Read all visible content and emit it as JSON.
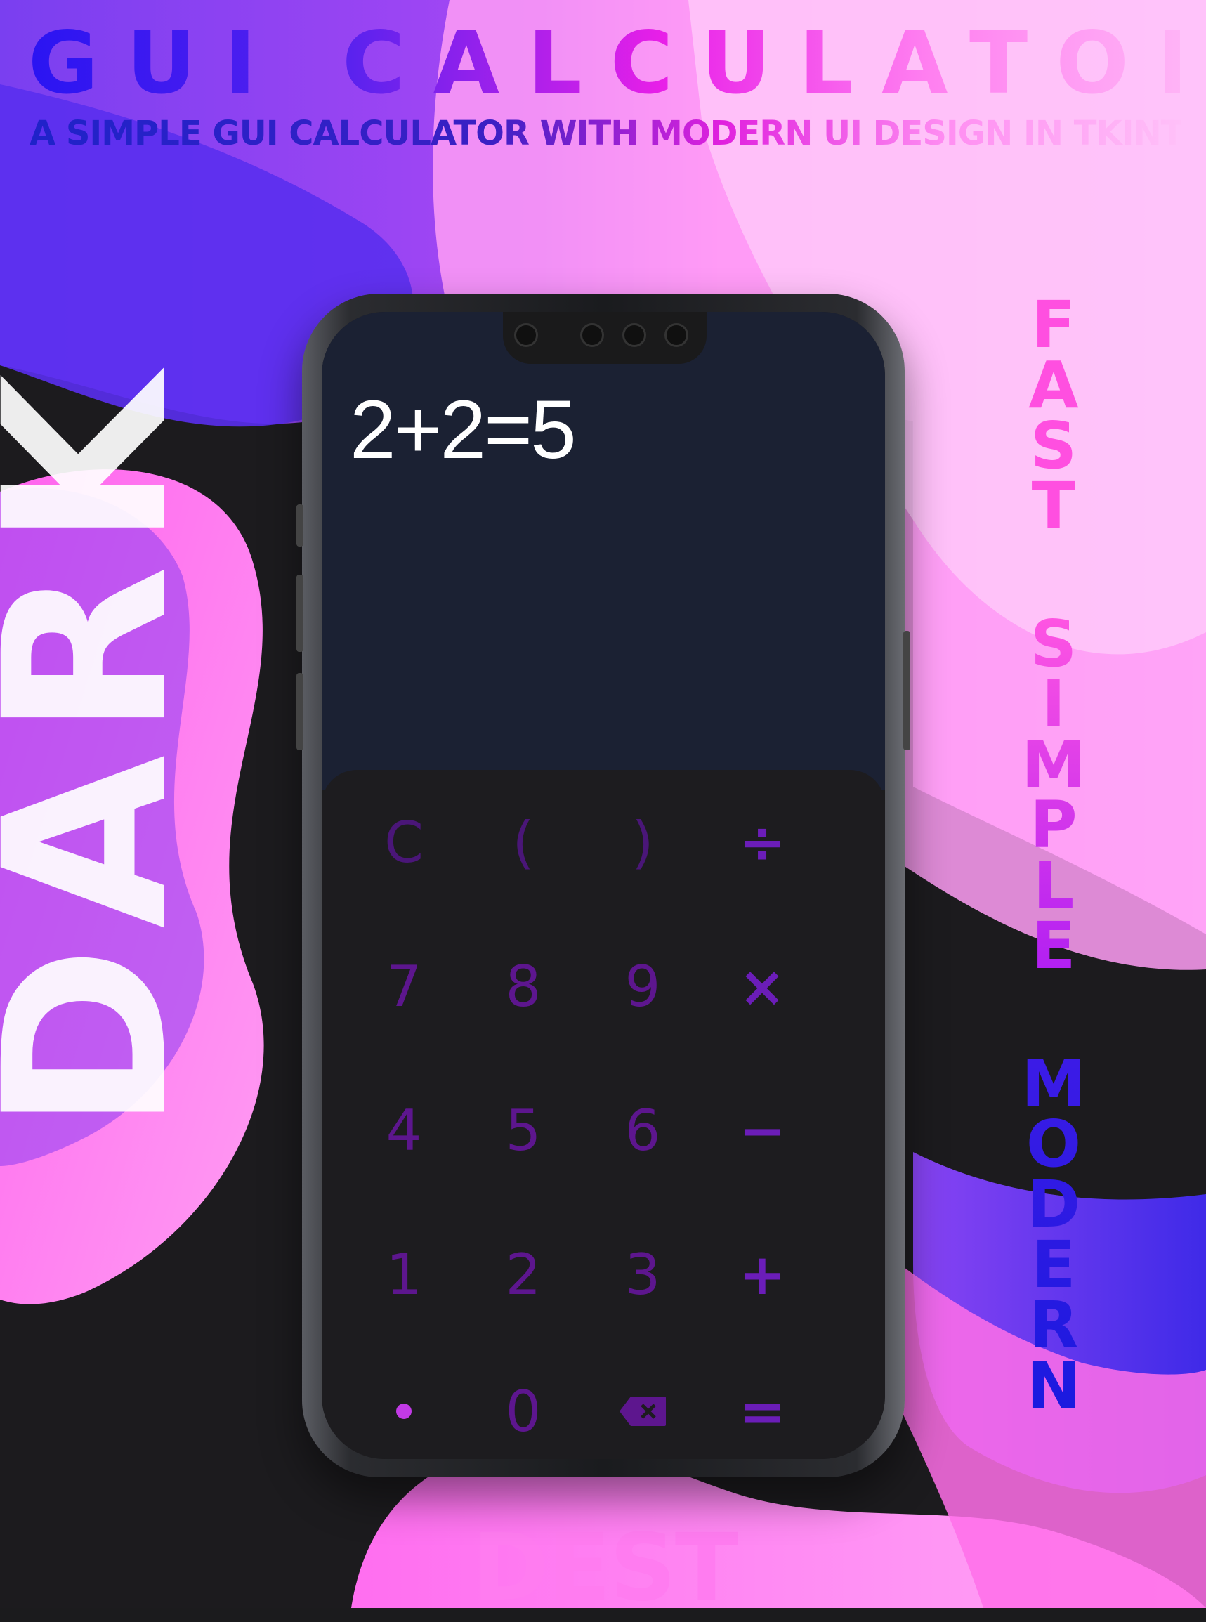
{
  "header": {
    "title": "GUI CALCULATOR",
    "subtitle": "A SIMPLE GUI CALCULATOR WITH MODERN UI DESIGN IN TKINTER"
  },
  "side_left": {
    "word": "DARK"
  },
  "side_right": {
    "words": [
      "FAST",
      "SIMPLE",
      "MODERN"
    ]
  },
  "footer": {
    "text": "DEST"
  },
  "calculator": {
    "display": "2+2=5",
    "keys": [
      [
        "C",
        "(",
        ")",
        "÷"
      ],
      [
        "7",
        "8",
        "9",
        "×"
      ],
      [
        "4",
        "5",
        "6",
        "−"
      ],
      [
        "1",
        "2",
        "3",
        "+"
      ],
      [
        "•",
        "0",
        "⌫",
        "="
      ]
    ]
  },
  "colors": {
    "key_color": "#5d168e",
    "operator_color": "#6b1db8",
    "display_bg": "#1b2133",
    "keypad_bg": "#1d1c1f"
  },
  "icons": {
    "backspace": "backspace-icon",
    "dot": "decimal-point-icon"
  }
}
